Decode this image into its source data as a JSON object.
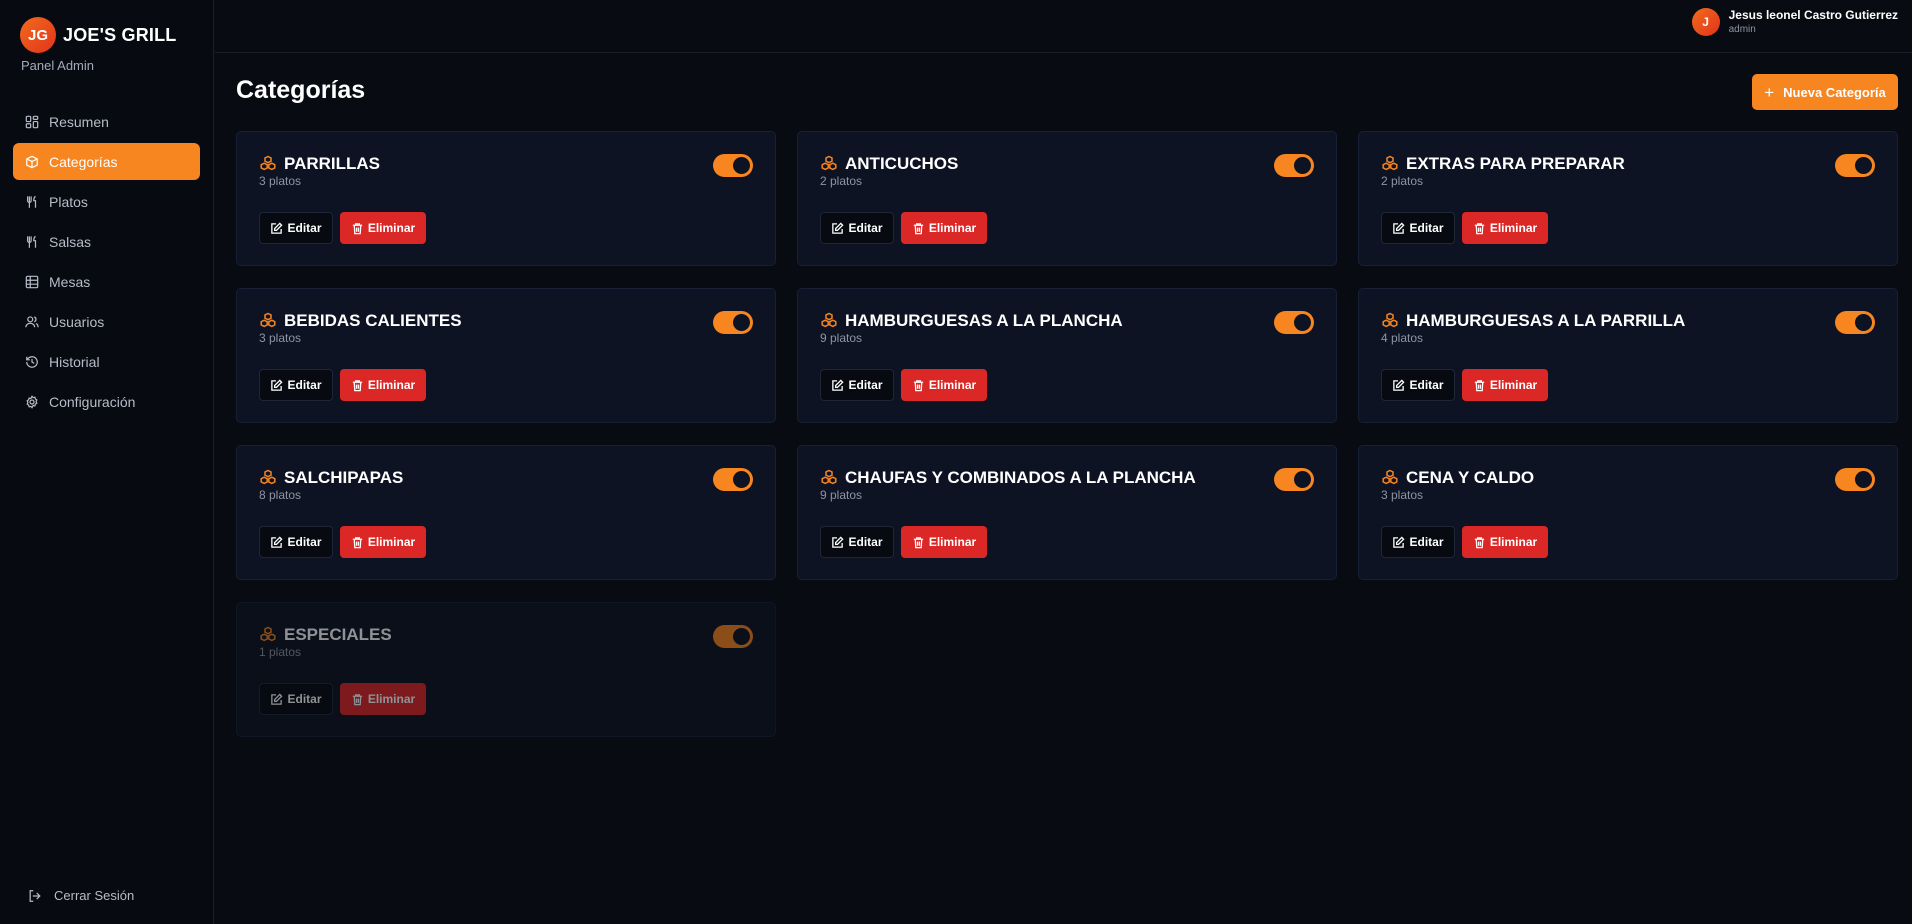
{
  "brand": {
    "initials": "JG",
    "name": "JOE'S GRILL",
    "subtitle": "Panel Admin"
  },
  "sidebar": {
    "items": [
      {
        "label": "Resumen",
        "icon": "dashboard-icon",
        "active": false
      },
      {
        "label": "Categorías",
        "icon": "box-icon",
        "active": true
      },
      {
        "label": "Platos",
        "icon": "utensils-icon",
        "active": false
      },
      {
        "label": "Salsas",
        "icon": "utensils-icon",
        "active": false
      },
      {
        "label": "Mesas",
        "icon": "table-icon",
        "active": false
      },
      {
        "label": "Usuarios",
        "icon": "users-icon",
        "active": false
      },
      {
        "label": "Historial",
        "icon": "history-icon",
        "active": false
      },
      {
        "label": "Configuración",
        "icon": "gear-icon",
        "active": false
      }
    ],
    "logout": "Cerrar Sesión"
  },
  "user": {
    "initial": "J",
    "name": "Jesus leonel Castro Gutierrez",
    "role": "admin"
  },
  "page": {
    "title": "Categorías",
    "new_button": "Nueva Categoría"
  },
  "buttons": {
    "edit": "Editar",
    "delete": "Eliminar"
  },
  "categories": [
    {
      "name": "PARRILLAS",
      "count": "3 platos",
      "enabled": true
    },
    {
      "name": "ANTICUCHOS",
      "count": "2 platos",
      "enabled": true
    },
    {
      "name": "EXTRAS PARA PREPARAR",
      "count": "2 platos",
      "enabled": true
    },
    {
      "name": "BEBIDAS CALIENTES",
      "count": "3 platos",
      "enabled": true
    },
    {
      "name": "HAMBURGUESAS A LA PLANCHA",
      "count": "9 platos",
      "enabled": true
    },
    {
      "name": "HAMBURGUESAS A LA PARRILLA",
      "count": "4 platos",
      "enabled": true
    },
    {
      "name": "SALCHIPAPAS",
      "count": "8 platos",
      "enabled": true
    },
    {
      "name": "CHAUFAS Y COMBINADOS A LA PLANCHA",
      "count": "9 platos",
      "enabled": true
    },
    {
      "name": "CENA Y CALDO",
      "count": "3 platos",
      "enabled": true
    },
    {
      "name": "ESPECIALES",
      "count": "1 platos",
      "enabled": false
    }
  ],
  "colors": {
    "accent": "#f78520",
    "danger": "#dc2727",
    "background": "#080b12",
    "card": "#0d1322"
  }
}
